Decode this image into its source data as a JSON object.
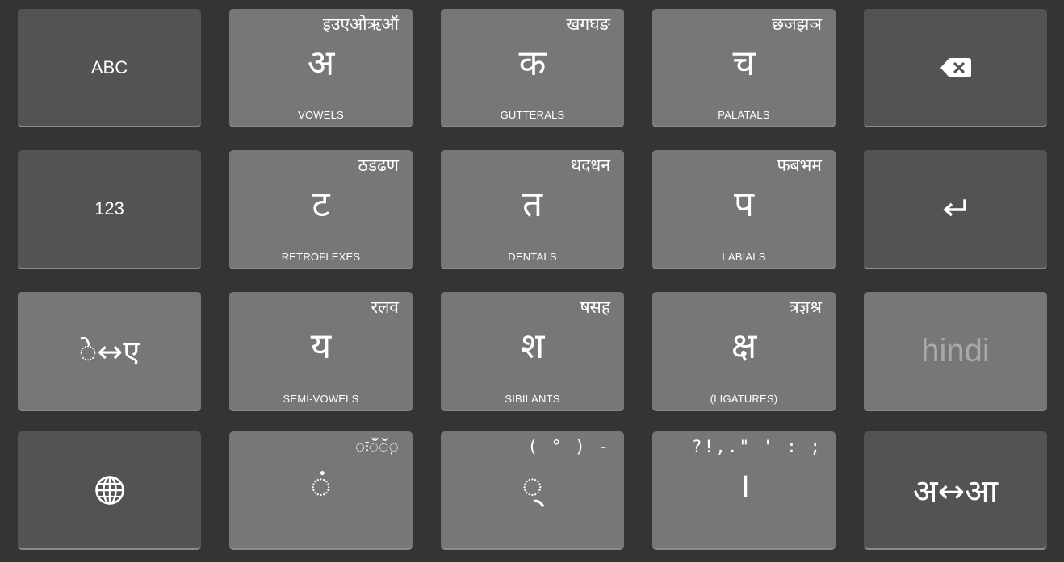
{
  "keyboard": {
    "row1": {
      "abc": {
        "label": "ABC"
      },
      "vowels": {
        "glyph": "अ",
        "hint": "इउएओऋऑ",
        "caption": "VOWELS"
      },
      "gutterals": {
        "glyph": "क",
        "hint": "खगघङ",
        "caption": "GUTTERALS"
      },
      "palatals": {
        "glyph": "च",
        "hint": "छजझञ",
        "caption": "PALATALS"
      },
      "backspace": {
        "icon": "backspace-icon"
      }
    },
    "row2": {
      "numbers": {
        "label": "123"
      },
      "retroflexes": {
        "glyph": "ट",
        "hint": "ठडढण",
        "caption": "RETROFLEXES"
      },
      "dentals": {
        "glyph": "त",
        "hint": "थदधन",
        "caption": "DENTALS"
      },
      "labials": {
        "glyph": "प",
        "hint": "फबभम",
        "caption": "LABIALS"
      },
      "enter": {
        "icon": "enter-icon"
      }
    },
    "row3": {
      "matra_swap": {
        "label": "◌े↔ए"
      },
      "semivowels": {
        "glyph": "य",
        "hint": "रलव",
        "caption": "SEMI-VOWELS"
      },
      "sibilants": {
        "glyph": "श",
        "hint": "षसह",
        "caption": "SIBILANTS"
      },
      "ligatures": {
        "glyph": "क्ष",
        "hint": "त्रज्ञश्र",
        "caption": "(LIGATURES)"
      },
      "language": {
        "label": "hindi"
      }
    },
    "row4": {
      "globe": {
        "icon": "globe-icon"
      },
      "diacritics": {
        "glyph": "◌ं",
        "hint": "◌ः◌ँ◌ॅ◌़"
      },
      "punct_virama": {
        "glyph": "◌्",
        "hint": "( ° ) -"
      },
      "danda": {
        "glyph": "।",
        "hint": "?!,.\" ' : ;"
      },
      "vowel_swap": {
        "label": "अ↔आ"
      }
    }
  }
}
